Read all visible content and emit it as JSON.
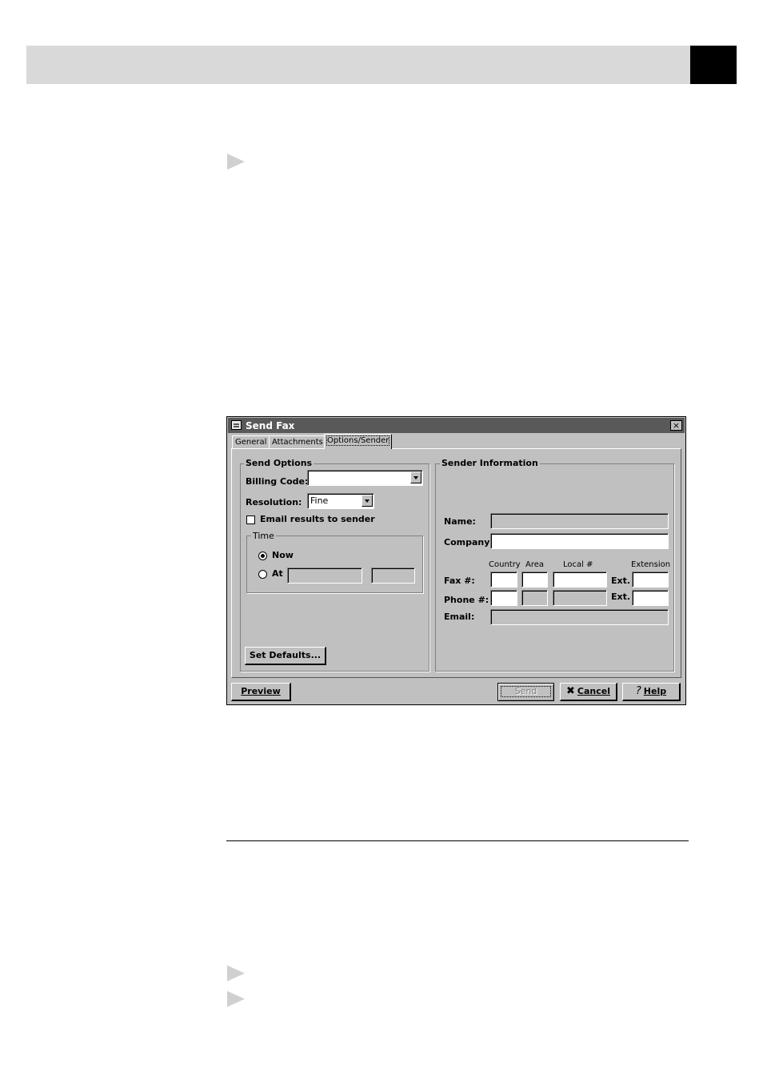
{
  "dialog": {
    "title": "Send Fax",
    "close_glyph": "×",
    "tabs": [
      {
        "label": "General"
      },
      {
        "label": "Attachments"
      },
      {
        "label": "Options/Sender"
      }
    ],
    "send_options": {
      "group_label": "Send Options",
      "billing_label": "Billing Code:",
      "billing_value": "",
      "resolution_label": "Resolution:",
      "resolution_value": "Fine",
      "email_checkbox_label": "Email results to sender",
      "time_group_label": "Time",
      "now_label": "Now",
      "at_label": "At",
      "set_defaults_label": "Set Defaults..."
    },
    "sender_info": {
      "group_label": "Sender Information",
      "name_label": "Name:",
      "company_label": "Company:",
      "col_country": "Country",
      "col_area": "Area",
      "col_local": "Local #",
      "col_extension": "Extension",
      "fax_label": "Fax #:",
      "phone_label": "Phone #:",
      "ext_label": "Ext.",
      "email_label": "Email:"
    },
    "buttons": {
      "preview": "Preview",
      "send": "Send",
      "cancel": "Cancel",
      "help": "Help"
    },
    "icons": {
      "cancel": "cancel-x-icon",
      "help": "help-question-icon",
      "title": "fax-icon"
    }
  }
}
